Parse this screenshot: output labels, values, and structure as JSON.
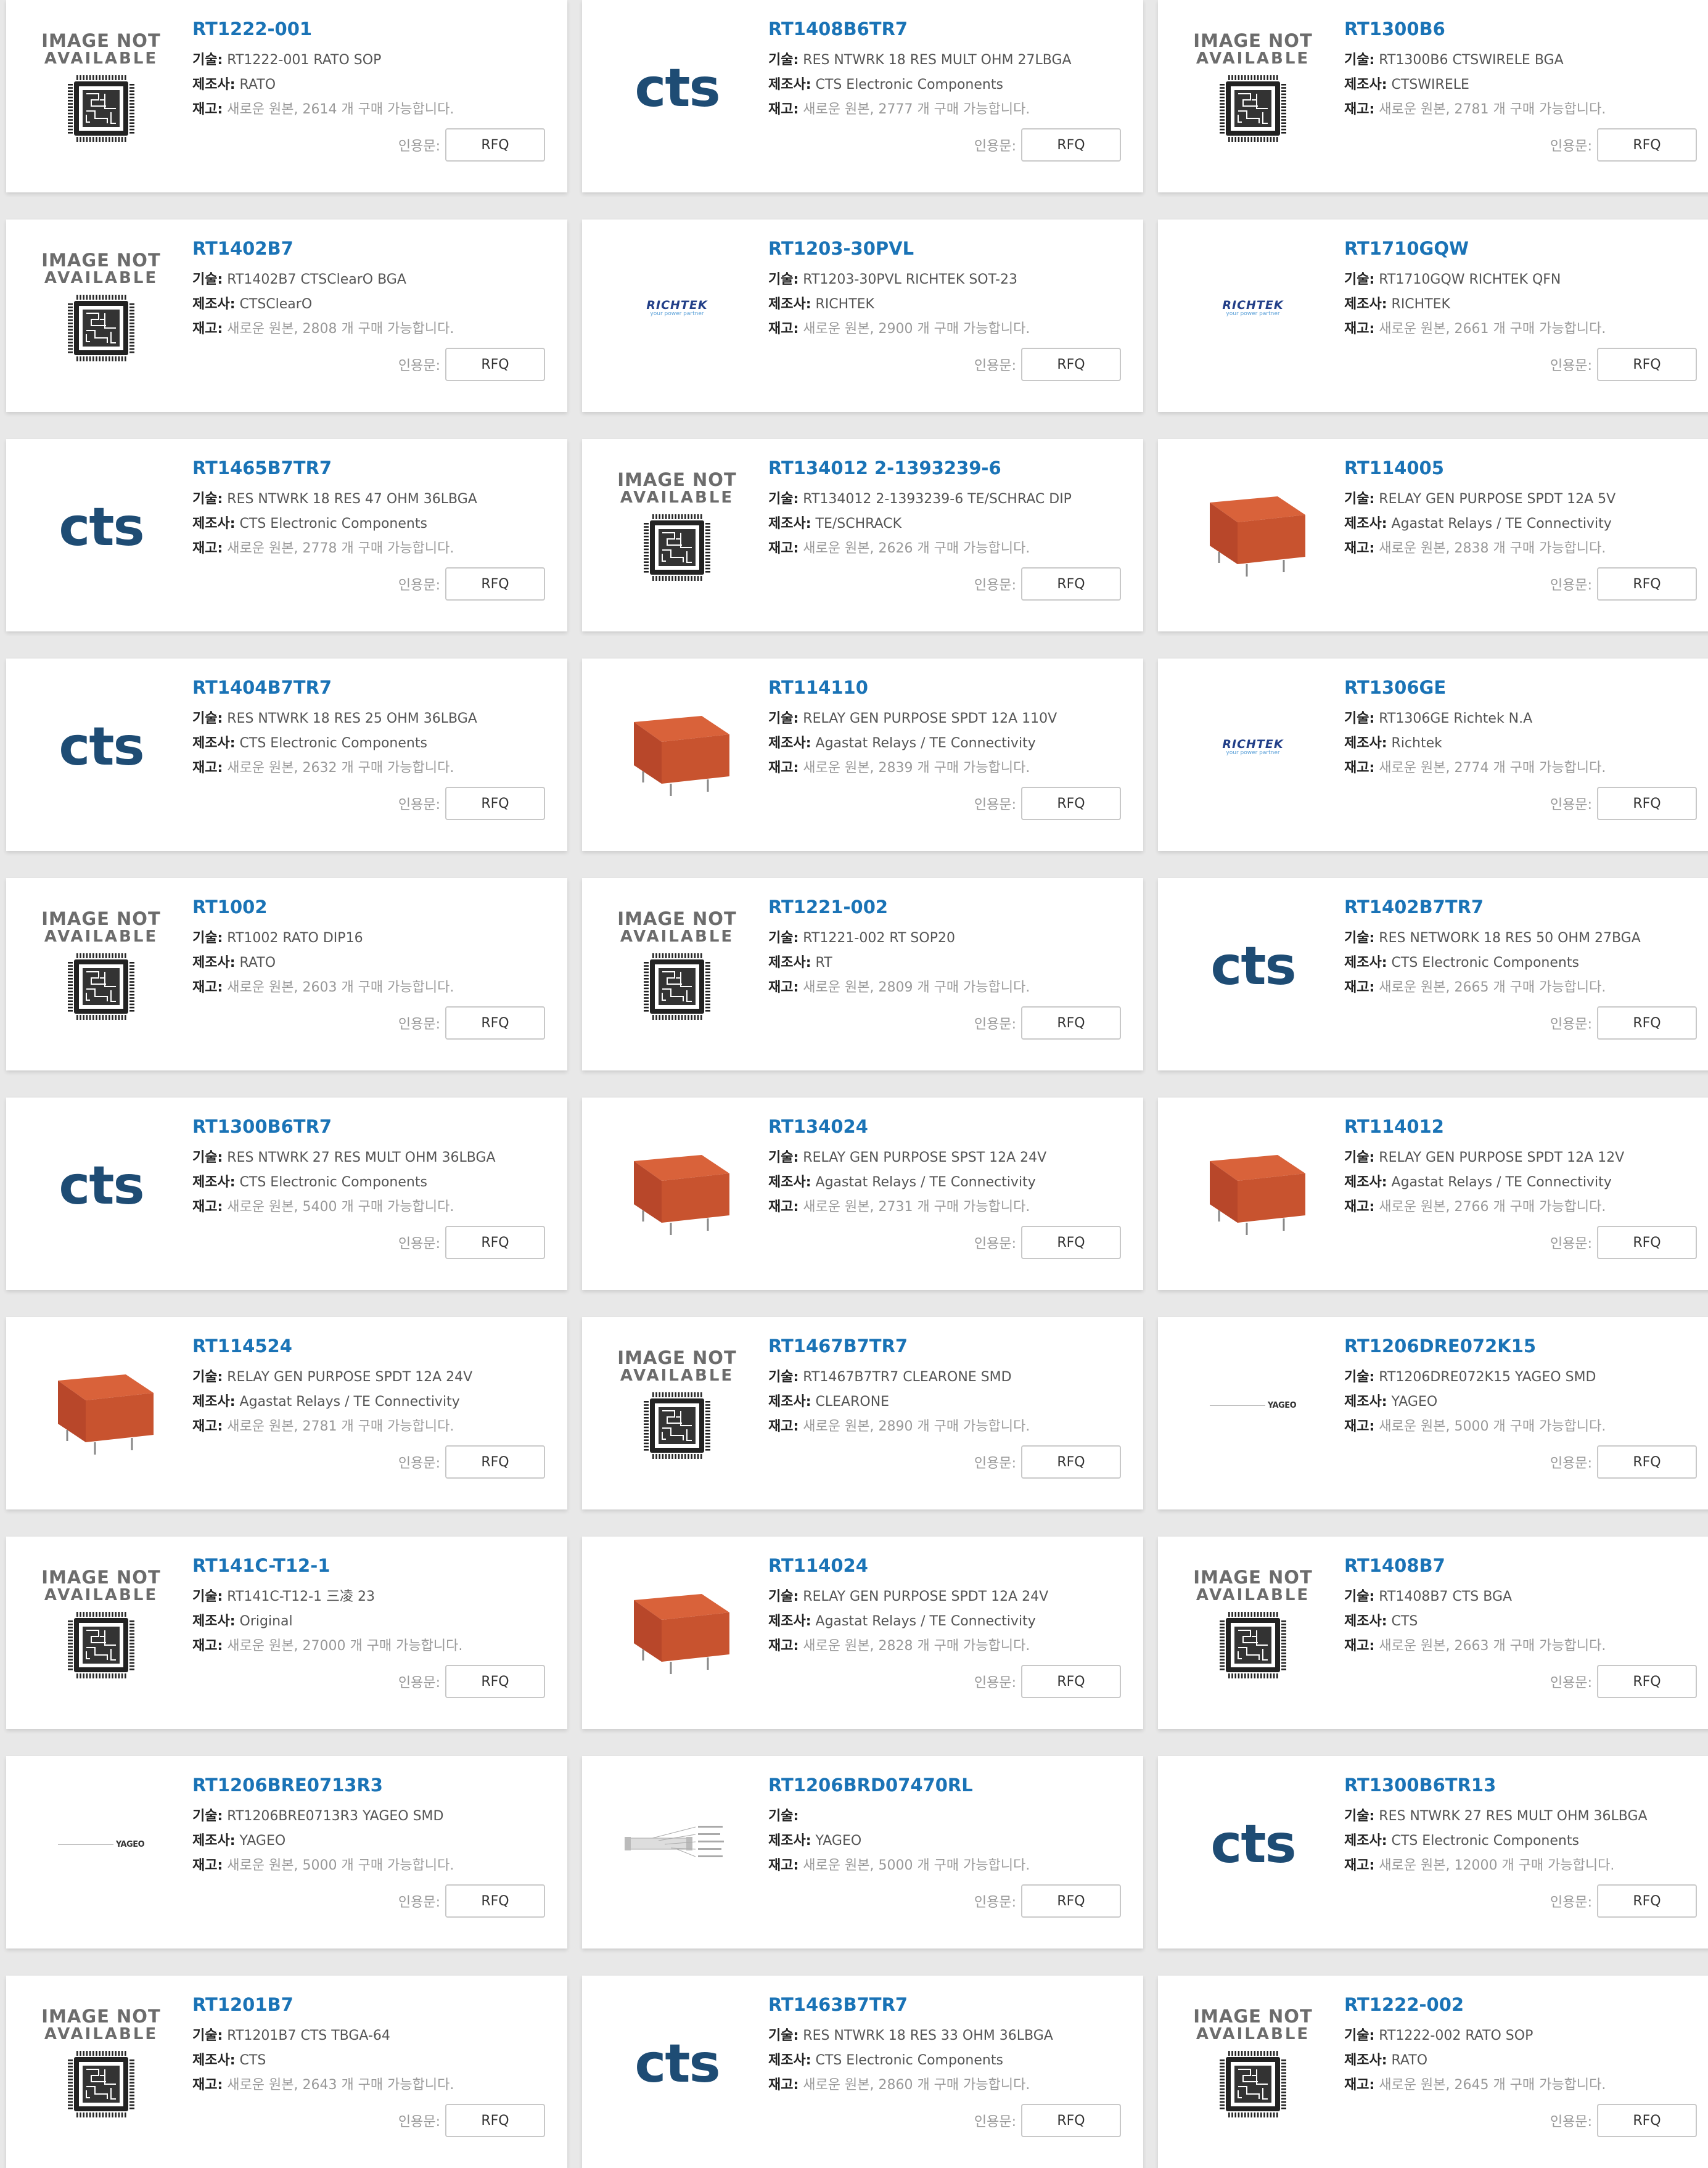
{
  "labels": {
    "desc": "기술:",
    "mfr": "제조사:",
    "stock": "재고:",
    "quote": "인용문:",
    "rfq": "RFQ"
  },
  "image_texts": {
    "not_available_1": "IMAGE NOT",
    "not_available_2": "AVAILABLE",
    "cts": "cts",
    "richtek": "RICHTEK",
    "richtek_tag": "your power partner",
    "yageo": "YAGEO"
  },
  "products": [
    {
      "pn": "RT1222-001",
      "image": "ina",
      "desc": "RT1222-001 RATO SOP",
      "mfr": "RATO",
      "stock": "새로운 원본, 2614 개 구매 가능합니다."
    },
    {
      "pn": "RT1408B6TR7",
      "image": "cts",
      "desc": "RES NTWRK 18 RES MULT OHM 27LBGA",
      "mfr": "CTS Electronic Components",
      "stock": "새로운 원본, 2777 개 구매 가능합니다."
    },
    {
      "pn": "RT1300B6",
      "image": "ina",
      "desc": "RT1300B6 CTSWIRELE BGA",
      "mfr": "CTSWIRELE",
      "stock": "새로운 원본, 2781 개 구매 가능합니다."
    },
    {
      "pn": "RT1402B7",
      "image": "ina",
      "desc": "RT1402B7 CTSClearO BGA",
      "mfr": "CTSClearO",
      "stock": "새로운 원본, 2808 개 구매 가능합니다."
    },
    {
      "pn": "RT1203-30PVL",
      "image": "richtek",
      "desc": "RT1203-30PVL RICHTEK SOT-23",
      "mfr": "RICHTEK",
      "stock": "새로운 원본, 2900 개 구매 가능합니다."
    },
    {
      "pn": "RT1710GQW",
      "image": "richtek",
      "desc": "RT1710GQW RICHTEK QFN",
      "mfr": "RICHTEK",
      "stock": "새로운 원본, 2661 개 구매 가능합니다."
    },
    {
      "pn": "RT1465B7TR7",
      "image": "cts",
      "desc": "RES NTWRK 18 RES 47 OHM 36LBGA",
      "mfr": "CTS Electronic Components",
      "stock": "새로운 원본, 2778 개 구매 가능합니다."
    },
    {
      "pn": "RT134012 2-1393239-6",
      "image": "ina",
      "desc": "RT134012 2-1393239-6 TE/SCHRAC DIP",
      "mfr": "TE/SCHRACK",
      "stock": "새로운 원본, 2626 개 구매 가능합니다."
    },
    {
      "pn": "RT114005",
      "image": "relay",
      "desc": "RELAY GEN PURPOSE SPDT 12A 5V",
      "mfr": "Agastat Relays / TE Connectivity",
      "stock": "새로운 원본, 2838 개 구매 가능합니다."
    },
    {
      "pn": "RT1404B7TR7",
      "image": "cts",
      "desc": "RES NTWRK 18 RES 25 OHM 36LBGA",
      "mfr": "CTS Electronic Components",
      "stock": "새로운 원본, 2632 개 구매 가능합니다."
    },
    {
      "pn": "RT114110",
      "image": "relay",
      "desc": "RELAY GEN PURPOSE SPDT 12A 110V",
      "mfr": "Agastat Relays / TE Connectivity",
      "stock": "새로운 원본, 2839 개 구매 가능합니다."
    },
    {
      "pn": "RT1306GE",
      "image": "richtek",
      "desc": "RT1306GE Richtek N.A",
      "mfr": "Richtek",
      "stock": "새로운 원본, 2774 개 구매 가능합니다."
    },
    {
      "pn": "RT1002",
      "image": "ina",
      "desc": "RT1002 RATO DIP16",
      "mfr": "RATO",
      "stock": "새로운 원본, 2603 개 구매 가능합니다."
    },
    {
      "pn": "RT1221-002",
      "image": "ina",
      "desc": "RT1221-002 RT SOP20",
      "mfr": "RT",
      "stock": "새로운 원본, 2809 개 구매 가능합니다."
    },
    {
      "pn": "RT1402B7TR7",
      "image": "cts",
      "desc": "RES NETWORK 18 RES 50 OHM 27BGA",
      "mfr": "CTS Electronic Components",
      "stock": "새로운 원본, 2665 개 구매 가능합니다."
    },
    {
      "pn": "RT1300B6TR7",
      "image": "cts",
      "desc": "RES NTWRK 27 RES MULT OHM 36LBGA",
      "mfr": "CTS Electronic Components",
      "stock": "새로운 원본, 5400 개 구매 가능합니다."
    },
    {
      "pn": "RT134024",
      "image": "relay",
      "desc": "RELAY GEN PURPOSE SPST 12A 24V",
      "mfr": "Agastat Relays / TE Connectivity",
      "stock": "새로운 원본, 2731 개 구매 가능합니다."
    },
    {
      "pn": "RT114012",
      "image": "relay",
      "desc": "RELAY GEN PURPOSE SPDT 12A 12V",
      "mfr": "Agastat Relays / TE Connectivity",
      "stock": "새로운 원본, 2766 개 구매 가능합니다."
    },
    {
      "pn": "RT114524",
      "image": "relay",
      "desc": "RELAY GEN PURPOSE SPDT 12A 24V",
      "mfr": "Agastat Relays / TE Connectivity",
      "stock": "새로운 원본, 2781 개 구매 가능합니다."
    },
    {
      "pn": "RT1467B7TR7",
      "image": "ina",
      "desc": "RT1467B7TR7 CLEARONE SMD",
      "mfr": "CLEARONE",
      "stock": "새로운 원본, 2890 개 구매 가능합니다."
    },
    {
      "pn": "RT1206DRE072K15",
      "image": "yageo",
      "desc": "RT1206DRE072K15 YAGEO SMD",
      "mfr": "YAGEO",
      "stock": "새로운 원본, 5000 개 구매 가능합니다."
    },
    {
      "pn": "RT141C-T12-1",
      "image": "ina",
      "desc": "RT141C-T12-1 三凌 23",
      "mfr": "Original",
      "stock": "새로운 원본, 27000 개 구매 가능합니다."
    },
    {
      "pn": "RT114024",
      "image": "relay",
      "desc": "RELAY GEN PURPOSE SPDT 12A 24V",
      "mfr": "Agastat Relays / TE Connectivity",
      "stock": "새로운 원본, 2828 개 구매 가능합니다."
    },
    {
      "pn": "RT1408B7",
      "image": "ina",
      "desc": "RT1408B7 CTS BGA",
      "mfr": "CTS",
      "stock": "새로운 원본, 2663 개 구매 가능합니다."
    },
    {
      "pn": "RT1206BRE0713R3",
      "image": "yageo",
      "desc": "RT1206BRE0713R3 YAGEO SMD",
      "mfr": "YAGEO",
      "stock": "새로운 원본, 5000 개 구매 가능합니다."
    },
    {
      "pn": "RT1206BRD07470RL",
      "image": "diagram",
      "desc": "",
      "mfr": "YAGEO",
      "stock": "새로운 원본, 5000 개 구매 가능합니다."
    },
    {
      "pn": "RT1300B6TR13",
      "image": "cts",
      "desc": "RES NTWRK 27 RES MULT OHM 36LBGA",
      "mfr": "CTS Electronic Components",
      "stock": "새로운 원본, 12000 개 구매 가능합니다."
    },
    {
      "pn": "RT1201B7",
      "image": "ina",
      "desc": "RT1201B7 CTS TBGA-64",
      "mfr": "CTS",
      "stock": "새로운 원본, 2643 개 구매 가능합니다."
    },
    {
      "pn": "RT1463B7TR7",
      "image": "cts",
      "desc": "RES NTWRK 18 RES 33 OHM 36LBGA",
      "mfr": "CTS Electronic Components",
      "stock": "새로운 원본, 2860 개 구매 가능합니다."
    },
    {
      "pn": "RT1222-002",
      "image": "ina",
      "desc": "RT1222-002 RATO SOP",
      "mfr": "RATO",
      "stock": "새로운 원본, 2645 개 구매 가능합니다."
    }
  ]
}
